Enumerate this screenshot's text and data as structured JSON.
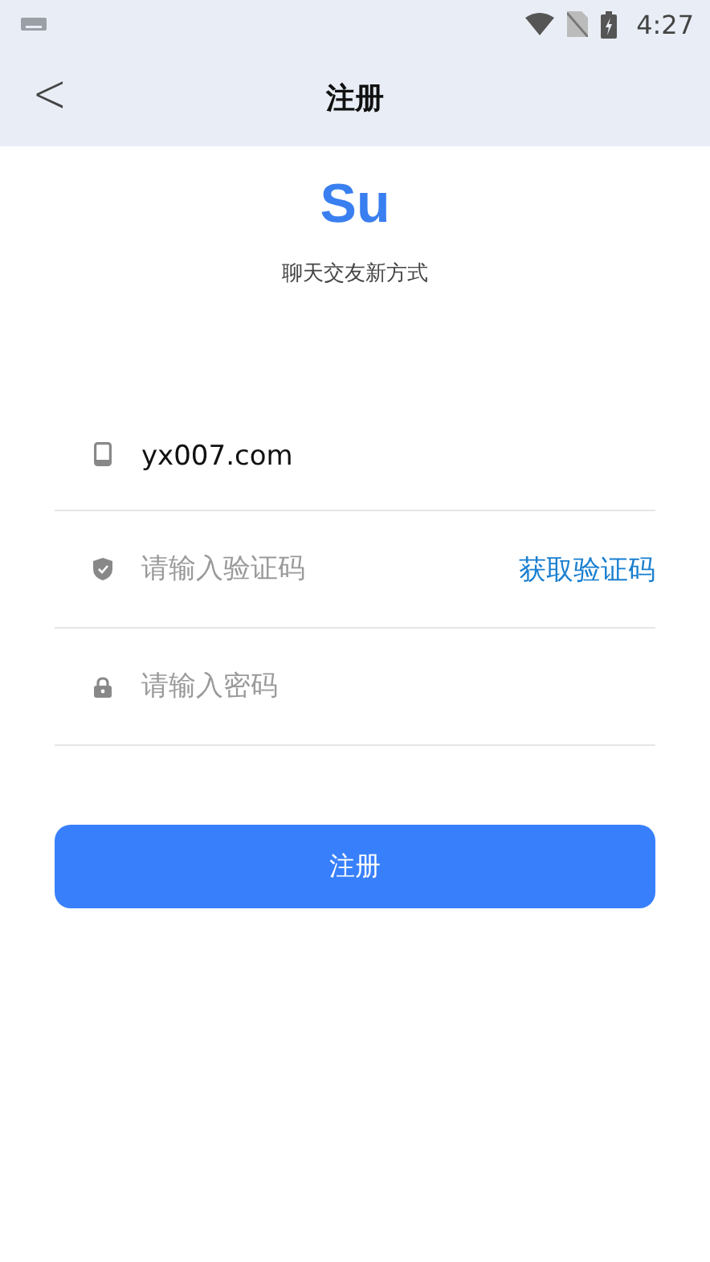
{
  "status_bar": {
    "time": "4:27"
  },
  "header": {
    "back": "<",
    "title": "注册"
  },
  "logo": {
    "text": "Su",
    "tagline": "聊天交友新方式"
  },
  "fields": [
    {
      "kind": "phone",
      "value": "yx007.com"
    },
    {
      "kind": "code",
      "placeholder": "请输入验证码",
      "action": "获取验证码"
    },
    {
      "kind": "password",
      "placeholder": "请输入密码"
    }
  ],
  "submit": "注册"
}
